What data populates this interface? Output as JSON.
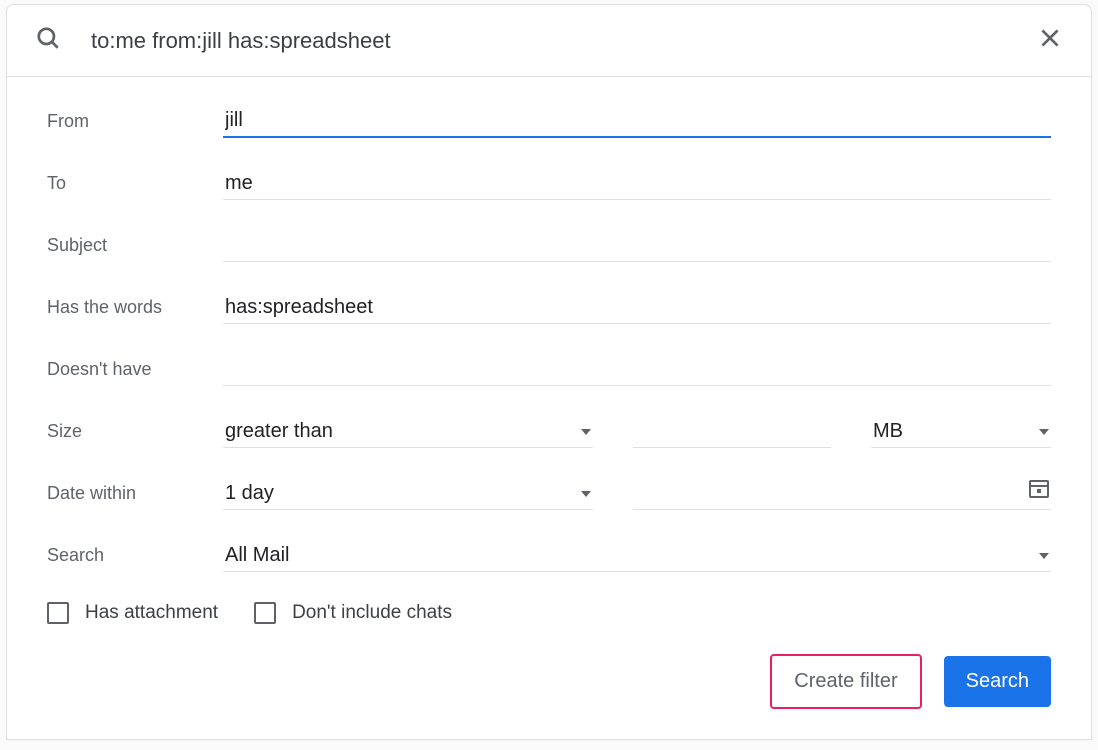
{
  "searchbar": {
    "query": "to:me from:jill has:spreadsheet"
  },
  "form": {
    "from": {
      "label": "From",
      "value": "jill"
    },
    "to": {
      "label": "To",
      "value": "me"
    },
    "subject": {
      "label": "Subject",
      "value": ""
    },
    "has_words": {
      "label": "Has the words",
      "value": "has:spreadsheet"
    },
    "doesnt_have": {
      "label": "Doesn't have",
      "value": ""
    },
    "size": {
      "label": "Size",
      "comparator": "greater than",
      "value": "",
      "unit": "MB"
    },
    "date_within": {
      "label": "Date within",
      "range": "1 day",
      "date": ""
    },
    "search_scope": {
      "label": "Search",
      "value": "All Mail"
    },
    "has_attachment": "Has attachment",
    "dont_include_chats": "Don't include chats"
  },
  "actions": {
    "create_filter": "Create filter",
    "search": "Search"
  }
}
